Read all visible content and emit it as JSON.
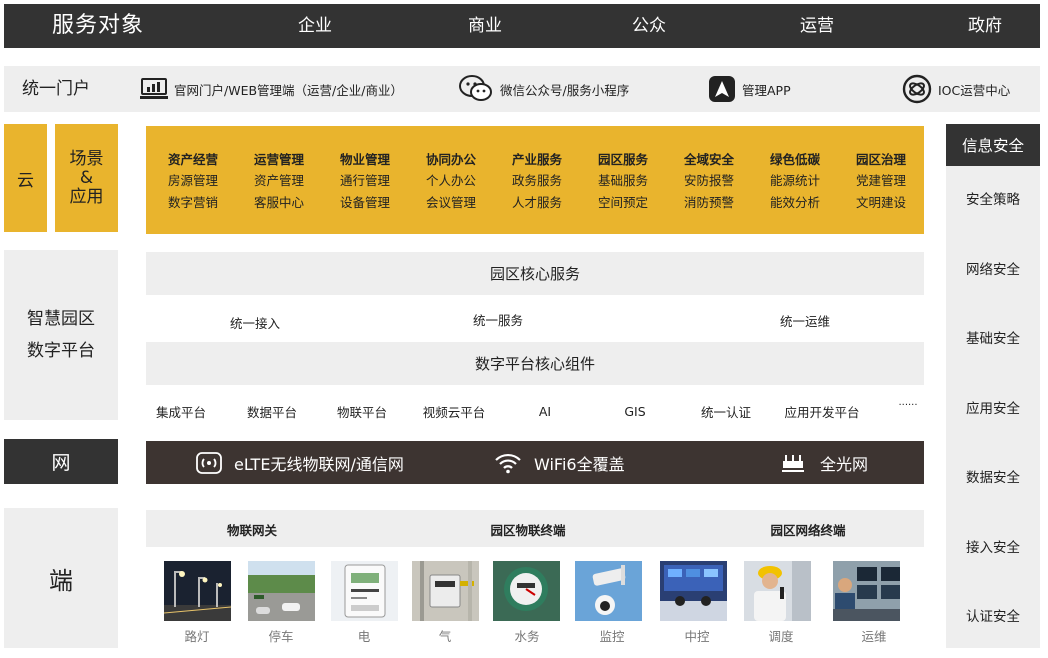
{
  "top_bar": {
    "title": "服务对象",
    "items": [
      "企业",
      "商业",
      "公众",
      "运营",
      "政府"
    ]
  },
  "portal": {
    "label": "统一门户",
    "items": [
      {
        "icon": "monitor-chart-icon",
        "label": "官网门户/WEB管理端（运营/企业/商业）"
      },
      {
        "icon": "wechat-icon",
        "label": "微信公众号/服务小程序"
      },
      {
        "icon": "app-logo-icon",
        "label": "管理APP"
      },
      {
        "icon": "ioc-circle-icon",
        "label": "IOC运营中心"
      }
    ]
  },
  "cloud": {
    "label": "云",
    "scene_label_line1": "场景",
    "scene_label_line2": "&",
    "scene_label_line3": "应用",
    "categories": [
      {
        "title": "资产经营",
        "items": [
          "房源管理",
          "数字营销"
        ]
      },
      {
        "title": "运营管理",
        "items": [
          "资产管理",
          "客服中心"
        ]
      },
      {
        "title": "物业管理",
        "items": [
          "通行管理",
          "设备管理"
        ]
      },
      {
        "title": "协同办公",
        "items": [
          "个人办公",
          "会议管理"
        ]
      },
      {
        "title": "产业服务",
        "items": [
          "政务服务",
          "人才服务"
        ]
      },
      {
        "title": "园区服务",
        "items": [
          "基础服务",
          "空间预定"
        ]
      },
      {
        "title": "全域安全",
        "items": [
          "安防报警",
          "消防预警"
        ]
      },
      {
        "title": "绿色低碳",
        "items": [
          "能源统计",
          "能效分析"
        ]
      },
      {
        "title": "园区治理",
        "items": [
          "党建管理",
          "文明建设"
        ]
      }
    ]
  },
  "platform": {
    "label_line1": "智慧园区",
    "label_line2": "数字平台",
    "core_services_title": "园区核心服务",
    "core_services": [
      "统一接入",
      "统一服务",
      "统一运维"
    ],
    "components_title": "数字平台核心组件",
    "components": [
      "集成平台",
      "数据平台",
      "物联平台",
      "视频云平台",
      "AI",
      "GIS",
      "统一认证",
      "应用开发平台",
      "······"
    ]
  },
  "network": {
    "label": "网",
    "items": [
      {
        "icon": "wireless-signal-icon",
        "label": "eLTE无线物联网/通信网"
      },
      {
        "icon": "wifi-icon",
        "label": "WiFi6全覆盖"
      },
      {
        "icon": "optical-router-icon",
        "label": "全光网"
      }
    ]
  },
  "terminal": {
    "label": "端",
    "headers": [
      "物联网关",
      "园区物联终端",
      "园区网络终端"
    ],
    "photos": [
      "路灯",
      "停车",
      "电",
      "气",
      "水务",
      "监控",
      "中控",
      "调度",
      "运维"
    ]
  },
  "security": {
    "title": "信息安全",
    "items": [
      "安全策略",
      "网络安全",
      "基础安全",
      "应用安全",
      "数据安全",
      "接入安全",
      "认证安全"
    ]
  },
  "colors": {
    "dark": "#333333",
    "yellow": "#e9b42d",
    "light_gray": "#eeeeee",
    "network_bar": "#3d3431"
  }
}
